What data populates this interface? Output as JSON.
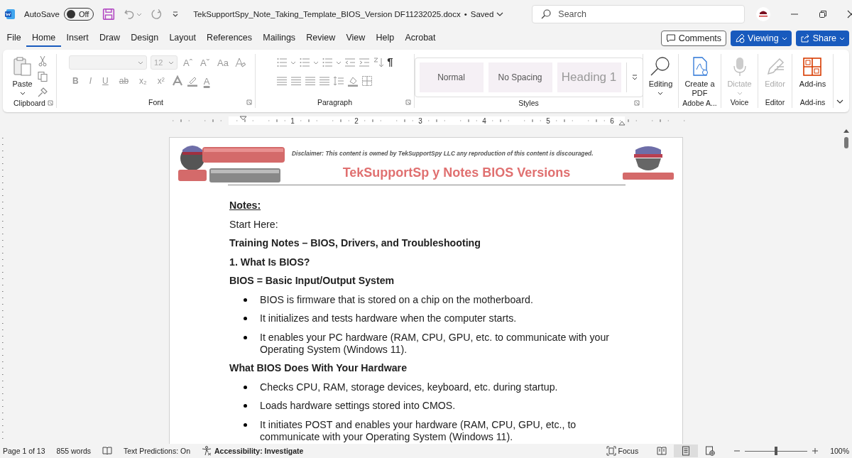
{
  "title_bar": {
    "autosave_label": "AutoSave",
    "autosave": {
      "on": false,
      "label": "Off"
    },
    "filename": "TekSupportSpy_Note_Taking_Template_BIOS_Version DF11232025.docx",
    "separator": "•",
    "save_status": "Saved",
    "search": {
      "placeholder": "Search"
    }
  },
  "menu_tabs": [
    {
      "label": "File",
      "selected": false
    },
    {
      "label": "Home",
      "selected": true
    },
    {
      "label": "Insert",
      "selected": false
    },
    {
      "label": "Draw",
      "selected": false
    },
    {
      "label": "Design",
      "selected": false
    },
    {
      "label": "Layout",
      "selected": false
    },
    {
      "label": "References",
      "selected": false
    },
    {
      "label": "Mailings",
      "selected": false
    },
    {
      "label": "Review",
      "selected": false
    },
    {
      "label": "View",
      "selected": false
    },
    {
      "label": "Help",
      "selected": false
    },
    {
      "label": "Acrobat",
      "selected": false
    }
  ],
  "top_buttons": [
    {
      "kind": "comments",
      "label": "Comments"
    },
    {
      "kind": "viewing",
      "label": "Viewing"
    },
    {
      "kind": "share",
      "label": "Share"
    }
  ],
  "ribbon": {
    "groups": [
      {
        "kind": "clipboard",
        "label": "Clipboard",
        "button": "Paste"
      },
      {
        "kind": "font",
        "label": "Font",
        "size": "12",
        "tools": [
          "Aˆ",
          "Aˇ",
          "Aa"
        ],
        "format": [
          "B",
          "I",
          "U",
          "ab",
          "x₂",
          "x²"
        ],
        "colors": [
          "A"
        ]
      },
      {
        "kind": "paragraph",
        "label": "Paragraph",
        "pilcrow": "¶"
      },
      {
        "kind": "styles",
        "label": "Styles",
        "styles": [
          {
            "name": "Normal",
            "kind": "normal"
          },
          {
            "name": "No Spacing",
            "kind": "normal"
          },
          {
            "name": "Heading 1",
            "kind": "heading"
          }
        ]
      },
      {
        "kind": "editing",
        "button": "Editing",
        "disabled": false
      },
      {
        "kind": "pdf",
        "label": "Adobe A...",
        "button": "Create a PDF",
        "disabled": false
      },
      {
        "kind": "dictate",
        "label": "Voice",
        "button": "Dictate",
        "disabled": true
      },
      {
        "kind": "editor",
        "label": "Editor",
        "button": "Editor",
        "disabled": true
      },
      {
        "kind": "addins",
        "label": "Add-ins",
        "button": "Add-ins",
        "disabled": false
      }
    ]
  },
  "ruler": {
    "numbers": [
      "1",
      "2",
      "3",
      "4",
      "5",
      "6"
    ]
  },
  "document": {
    "header": {
      "disclaimer": "Disclaimer: This content is owned by TekSupportSpy LLC any reproduction of this content is discouraged.",
      "title": "TekSupportSp y Notes BIOS Versions"
    },
    "blocks": [
      {
        "kind": "heading",
        "text": "Notes:"
      },
      {
        "kind": "text",
        "text": "Start Here:"
      },
      {
        "kind": "bold",
        "text": "Training Notes – BIOS, Drivers, and Troubleshooting"
      },
      {
        "kind": "bold",
        "text": "1. What Is BIOS?"
      },
      {
        "kind": "bold",
        "text": "BIOS = Basic Input/Output System"
      },
      {
        "kind": "bullet",
        "text": "BIOS is firmware that is stored on a chip on the motherboard."
      },
      {
        "kind": "bullet",
        "text": "It initializes and tests hardware when the computer starts."
      },
      {
        "kind": "bullet",
        "text": "It enables your PC hardware (RAM, CPU, GPU, etc. to communicate with your Operating System (Windows 11)."
      },
      {
        "kind": "bold",
        "text": "What BIOS Does With Your Hardware"
      },
      {
        "kind": "bullet",
        "text": "Checks CPU, RAM, storage devices, keyboard, etc. during startup."
      },
      {
        "kind": "bullet",
        "text": "Loads hardware settings stored into CMOS."
      },
      {
        "kind": "bullet",
        "text": "It initiates POST and enables your hardware (RAM, CPU, GPU, etc., to communicate with your Operating System (Windows 11)."
      }
    ]
  },
  "status_bar": {
    "page": "Page 1 of 13",
    "words": "855 words",
    "predictions": "Text Predictions: On",
    "accessibility": "Accessibility: Investigate",
    "focus": "Focus",
    "views": [
      {
        "kind": "read",
        "selected": false
      },
      {
        "kind": "print",
        "selected": true
      },
      {
        "kind": "web",
        "selected": false
      }
    ],
    "zoom": {
      "level": 0.5,
      "label": "100%"
    }
  }
}
